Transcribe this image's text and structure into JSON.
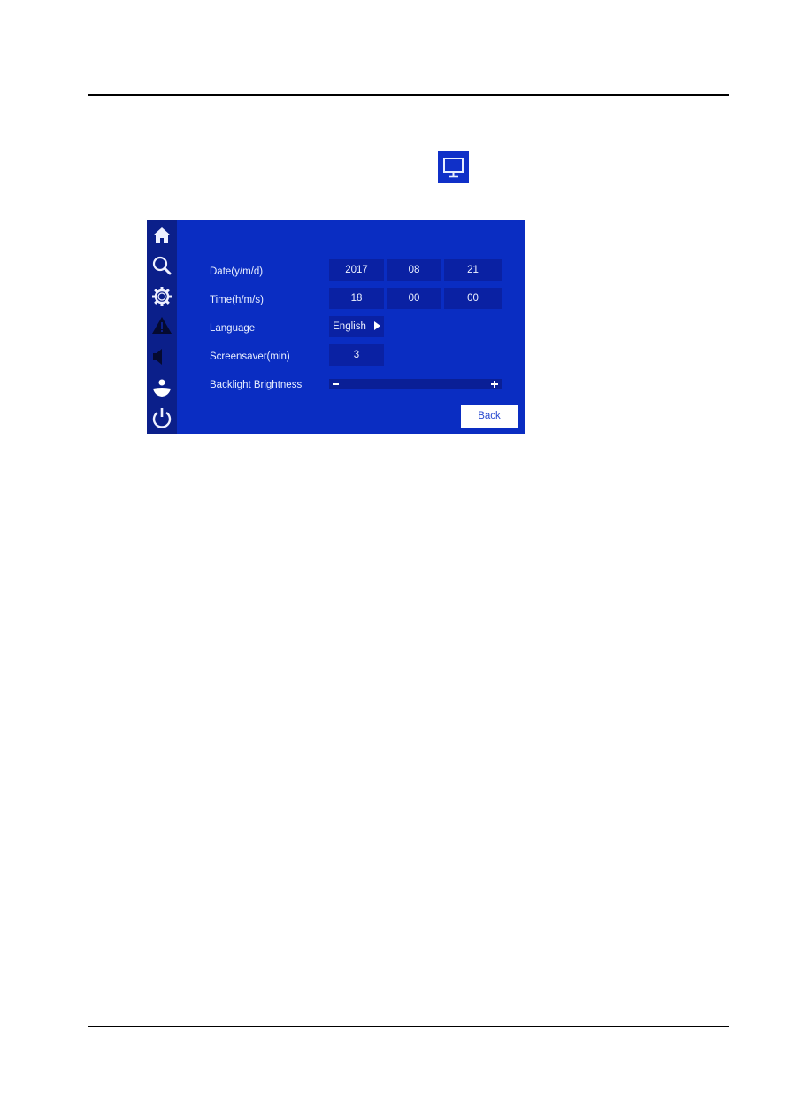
{
  "toolbar_icon": {
    "name": "display-settings",
    "icon": "monitor-icon",
    "bg": "#1030c8"
  },
  "screen": {
    "colors": {
      "panel": "#0a2dc2",
      "sidebar": "#0b1f8a",
      "field": "#0a21a3",
      "text": "#eaf0ff"
    },
    "sidebar": {
      "items": [
        {
          "icon": "home-icon"
        },
        {
          "icon": "search-icon"
        },
        {
          "icon": "gear-icon"
        },
        {
          "icon": "alarm-warning-icon"
        },
        {
          "icon": "speaker-icon"
        },
        {
          "icon": "user-icon"
        },
        {
          "icon": "power-icon"
        }
      ]
    },
    "settings": {
      "date": {
        "label": "Date(y/m/d)",
        "year": "2017",
        "month": "08",
        "day": "21"
      },
      "time": {
        "label": "Time(h/m/s)",
        "hour": "18",
        "minute": "00",
        "second": "00"
      },
      "language": {
        "label": "Language",
        "value": "English"
      },
      "screensaver": {
        "label": "Screensaver(min)",
        "value": "3"
      },
      "backlight": {
        "label": "Backlight Brightness",
        "minus": "−",
        "plus": "+"
      }
    },
    "back_label": "Back"
  }
}
